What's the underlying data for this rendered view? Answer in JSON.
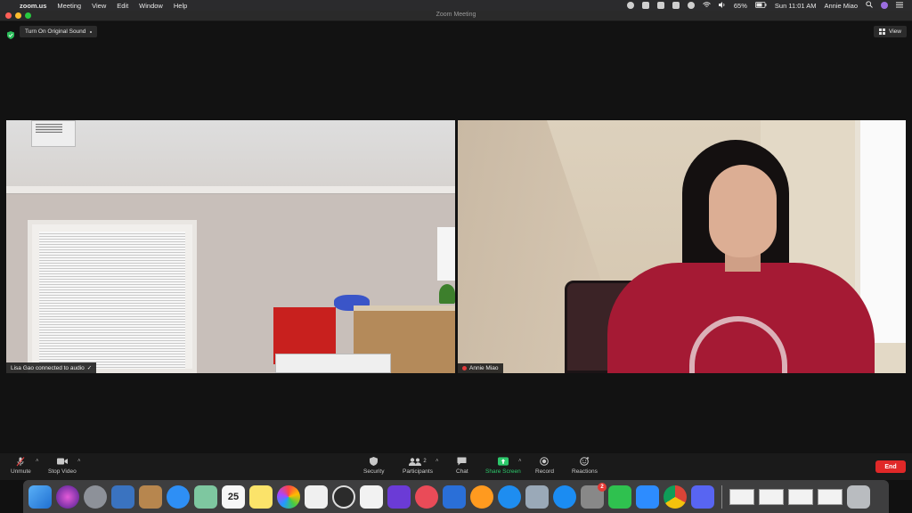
{
  "menubar": {
    "app": "zoom.us",
    "menus": [
      "Meeting",
      "View",
      "Edit",
      "Window",
      "Help"
    ],
    "battery": "65%",
    "datetime": "Sun 11:01 AM",
    "user": "Annie Miao"
  },
  "window": {
    "title": "Zoom Meeting"
  },
  "meeting": {
    "original_sound_label": "Turn On Original Sound",
    "view_label": "View",
    "left_tile_status": "Lisa Gao connected to audio",
    "right_tile_name": "Annie Miao"
  },
  "toolbar": {
    "unmute": "Unmute",
    "stop_video": "Stop Video",
    "security": "Security",
    "participants": "Participants",
    "participants_count": "2",
    "chat": "Chat",
    "share_screen": "Share Screen",
    "record": "Record",
    "reactions": "Reactions",
    "end": "End"
  },
  "dock": {
    "calendar_day": "25",
    "settings_badge": "2"
  },
  "colors": {
    "end_red": "#e02828",
    "share_green": "#2cc86b",
    "shield_green": "#2bbd5a"
  }
}
